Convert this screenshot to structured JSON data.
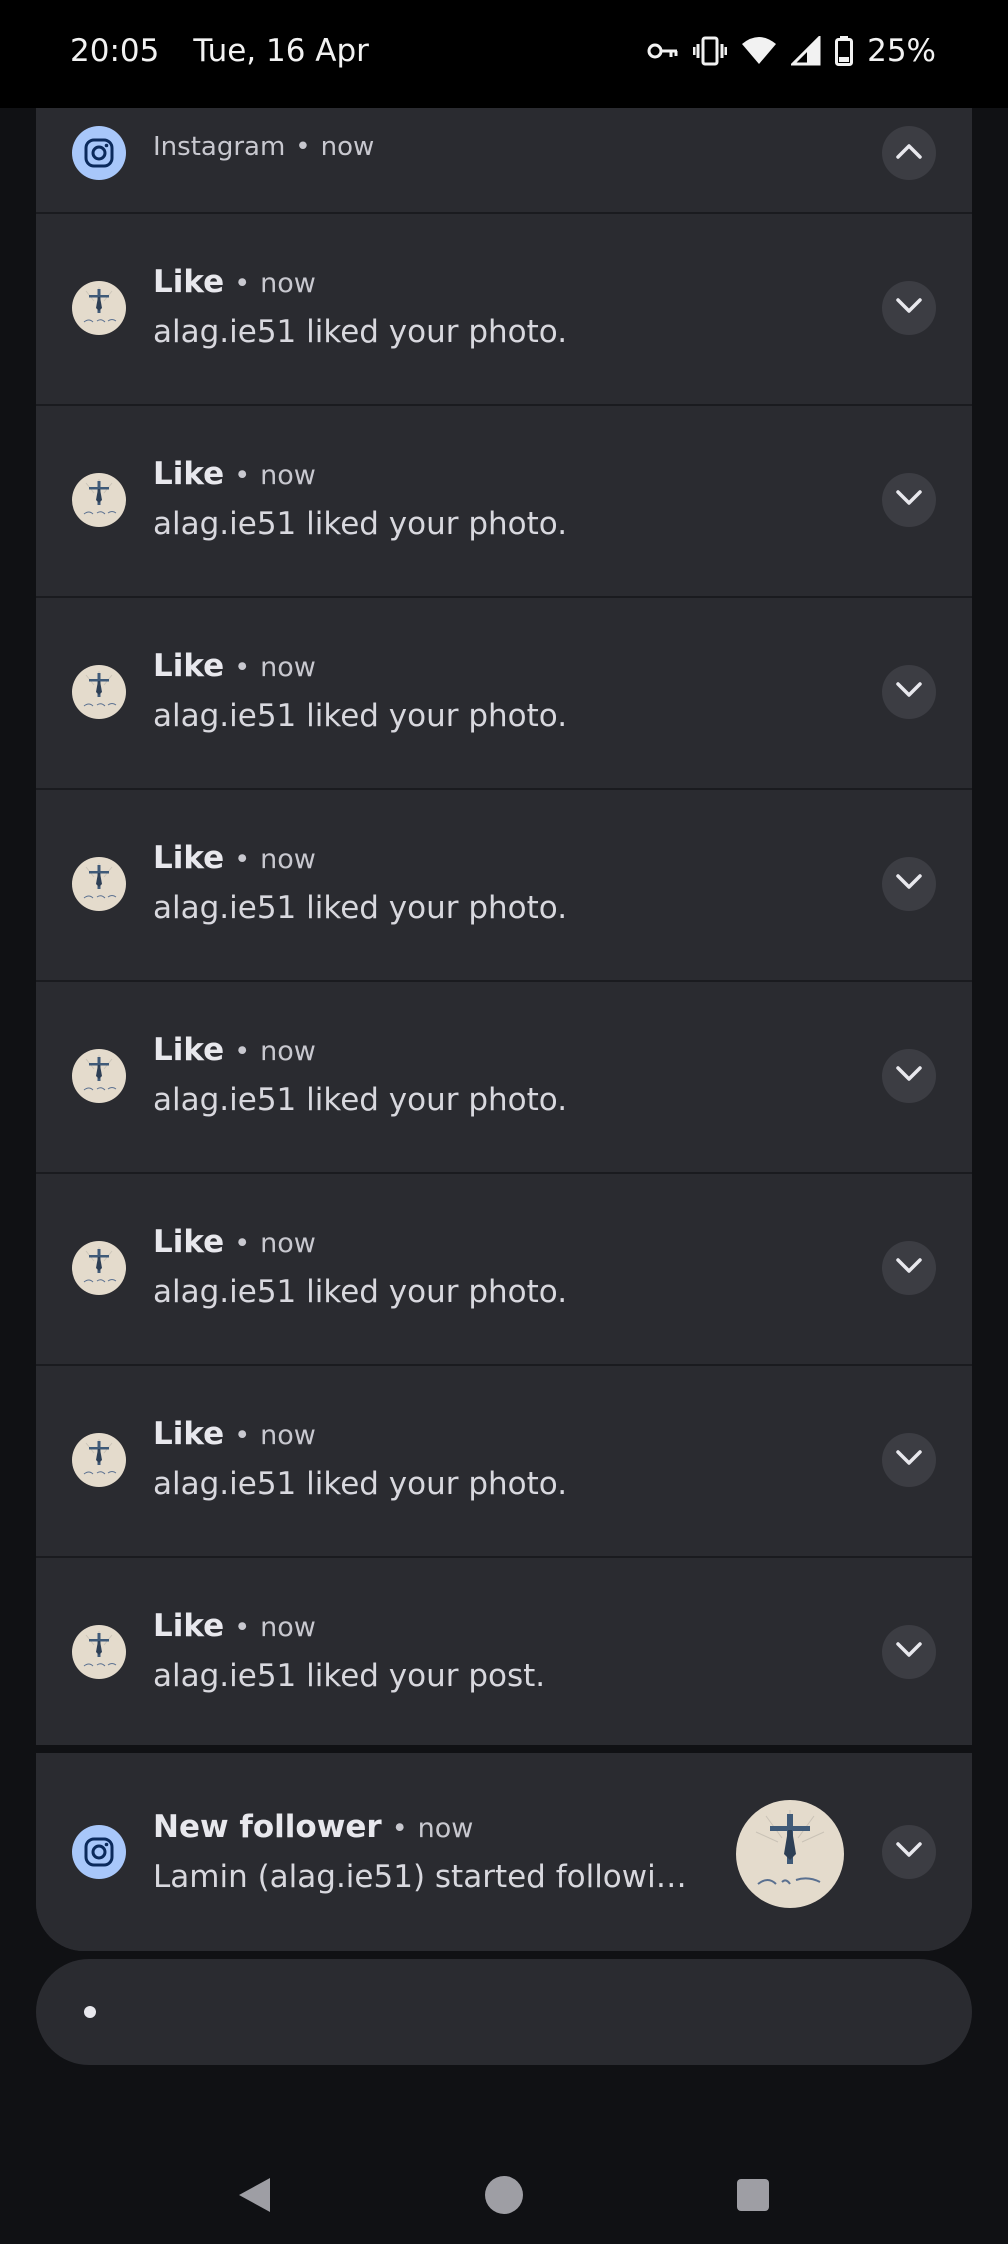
{
  "status_bar": {
    "time": "20:05",
    "date": "Tue, 16 Apr",
    "battery_percent": "25%",
    "icons": [
      "vpn-key-icon",
      "vibrate-icon",
      "wifi-icon",
      "signal-icon",
      "battery-icon"
    ]
  },
  "app_group": {
    "app_name": "Instagram",
    "separator": "•",
    "time": "now",
    "icon": "instagram-icon",
    "expand_icon": "chevron-up-icon"
  },
  "notifications": [
    {
      "title": "Like",
      "separator": "•",
      "time": "now",
      "body": "alag.ie51 liked your photo."
    },
    {
      "title": "Like",
      "separator": "•",
      "time": "now",
      "body": "alag.ie51 liked your photo."
    },
    {
      "title": "Like",
      "separator": "•",
      "time": "now",
      "body": "alag.ie51 liked your photo."
    },
    {
      "title": "Like",
      "separator": "•",
      "time": "now",
      "body": "alag.ie51 liked your photo."
    },
    {
      "title": "Like",
      "separator": "•",
      "time": "now",
      "body": "alag.ie51 liked your photo."
    },
    {
      "title": "Like",
      "separator": "•",
      "time": "now",
      "body": "alag.ie51 liked your photo."
    },
    {
      "title": "Like",
      "separator": "•",
      "time": "now",
      "body": "alag.ie51 liked your photo."
    },
    {
      "title": "Like",
      "separator": "•",
      "time": "now",
      "body": "alag.ie51 liked your post."
    }
  ],
  "follower_notification": {
    "title": "New follower",
    "separator": "•",
    "time": "now",
    "body": "Lamin (alag.ie51) started following y...",
    "icon": "instagram-icon",
    "expand_icon": "chevron-down-icon"
  },
  "colors": {
    "app_icon_bg": "#a8c7fa",
    "card_bg": "#2a2b30",
    "shade_bg": "#101114"
  }
}
